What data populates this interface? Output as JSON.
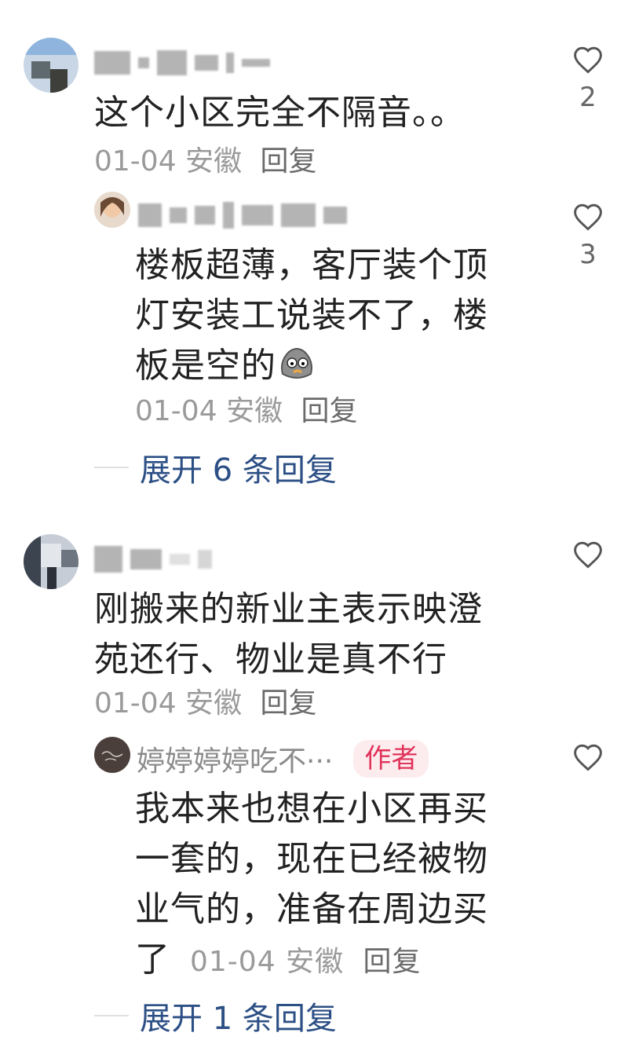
{
  "comments": [
    {
      "text": "这个小区完全不隔音。。",
      "date": "01-04",
      "location": "安徽",
      "reply_label": "回复",
      "likes": "2",
      "replies": [
        {
          "text_lines": [
            "楼板超薄，客厅装个顶",
            "灯安装工说装不了，楼",
            "板是空的"
          ],
          "date": "01-04",
          "location": "安徽",
          "reply_label": "回复",
          "likes": "3"
        }
      ],
      "expand_label": "展开 6 条回复"
    },
    {
      "text_lines": [
        "刚搬来的新业主表示映澄",
        "苑还行、物业是真不行"
      ],
      "date": "01-04",
      "location": "安徽",
      "reply_label": "回复",
      "replies": [
        {
          "name": "婷婷婷婷吃不···",
          "badge": "作者",
          "text_lines": [
            "我本来也想在小区再买",
            "一套的，现在已经被物",
            "业气的，准备在周边买",
            "了"
          ],
          "date": "01-04",
          "location": "安徽",
          "reply_label": "回复"
        }
      ],
      "expand_label": "展开 1 条回复"
    }
  ],
  "icons": {
    "like": "heart-outline-icon",
    "emoji": "sad-emoji-icon"
  },
  "colors": {
    "link": "#2c4f85",
    "badge_text": "#e0335a",
    "badge_bg": "#fdecee",
    "meta": "#9a9a9a"
  }
}
